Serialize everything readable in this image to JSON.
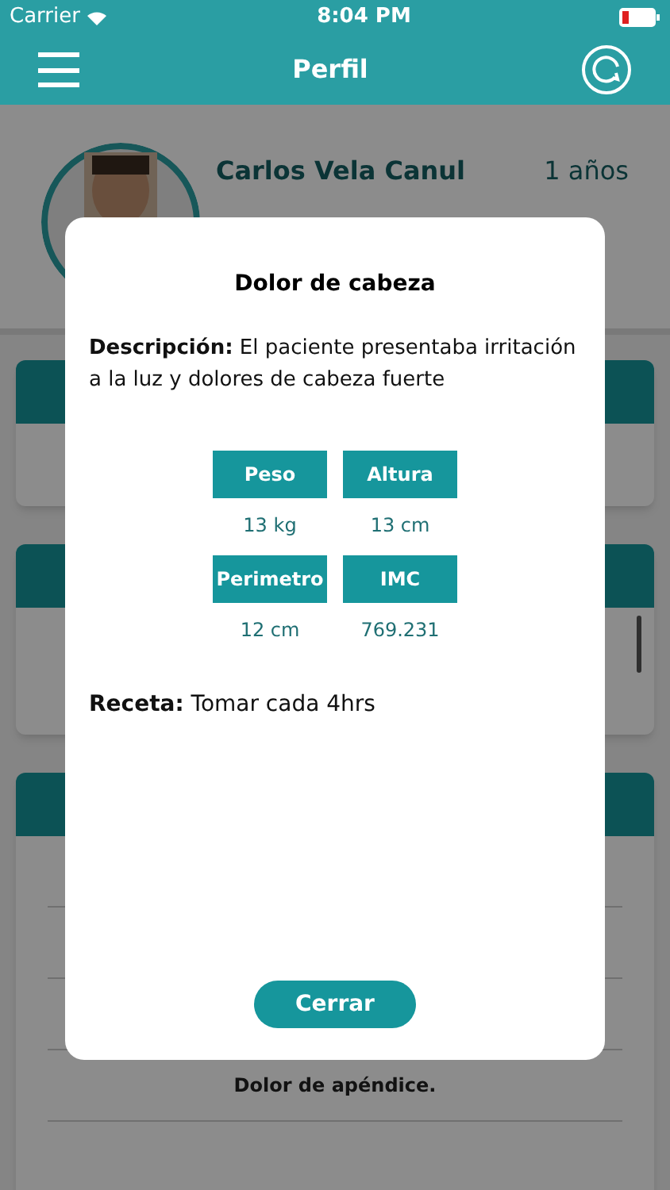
{
  "status_bar": {
    "carrier": "Carrier",
    "time": "8:04 PM"
  },
  "nav": {
    "title": "Perfil"
  },
  "profile": {
    "name": "Carlos Vela Canul",
    "age": "1 años"
  },
  "cards": [
    {
      "kind": "short"
    },
    {
      "kind": "scroll"
    },
    {
      "kind": "list",
      "rows": [
        "Dolor de apéndice."
      ]
    }
  ],
  "modal": {
    "title": "Dolor de cabeza",
    "description_label": "Descripción:",
    "description": "El paciente presentaba irritación a la luz y dolores de cabeza fuerte",
    "measures": [
      {
        "label": "Peso",
        "value": "13 kg"
      },
      {
        "label": "Altura",
        "value": "13 cm"
      },
      {
        "label": "Perimetro",
        "value": "12 cm"
      },
      {
        "label": "IMC",
        "value": "769.231"
      }
    ],
    "prescription_label": "Receta:",
    "prescription": "Tomar cada 4hrs",
    "close": "Cerrar"
  }
}
